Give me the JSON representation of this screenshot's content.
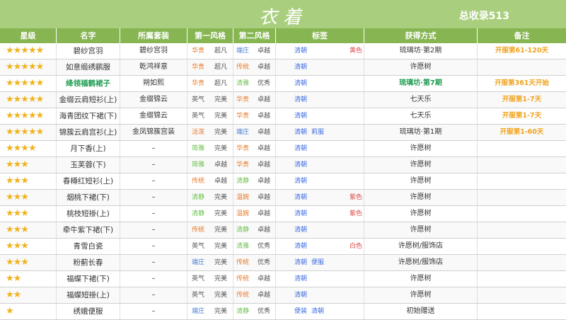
{
  "header": {
    "title": "衣着",
    "total": "总收录513"
  },
  "columns": [
    "星级",
    "名字",
    "所属套装",
    "第一风格",
    "第二风格",
    "标签",
    "获得方式",
    "备注"
  ],
  "colors": {
    "header_green": "#86b552",
    "title_green": "#a9cf7e",
    "star_gold": "#f0b31e",
    "style_orange": "#e87a2a",
    "style_green": "#6cbf4a",
    "style_blue": "#4a7fd0",
    "tag_blue": "#3f6ce0",
    "tag_red": "#e04a4a",
    "note_orange": "#f0a21e",
    "teal": "#1e9c50"
  },
  "rows": [
    {
      "stars": "★★★★★",
      "name": "碧纱宫羽",
      "set": "碧纱宫羽",
      "s1": "华贵",
      "s1c": "#e87a2a",
      "s1v": "超凡",
      "s2": "端庄",
      "s2c": "#4a7fd0",
      "s2v": "卓越",
      "tag1": "清朝",
      "tag2": "黄色",
      "tag2c": "#e04a4a",
      "obtain": "琉璃坊·第2期",
      "note": "开服第61-120天",
      "teal": false
    },
    {
      "stars": "★★★★★",
      "name": "如意缎绣鹂服",
      "set": "乾鸿祥意",
      "s1": "华贵",
      "s1c": "#e87a2a",
      "s1v": "超凡",
      "s2": "传统",
      "s2c": "#e87a2a",
      "s2v": "卓越",
      "tag1": "清朝",
      "tag2": "",
      "tag2c": "#e04a4a",
      "obtain": "许愿树",
      "note": "",
      "teal": false
    },
    {
      "stars": "★★★★★",
      "name": "绛领福鹤裙子",
      "set": "朔如熙",
      "s1": "华贵",
      "s1c": "#e87a2a",
      "s1v": "超凡",
      "s2": "清雅",
      "s2c": "#6cbf4a",
      "s2v": "优秀",
      "tag1": "清朝",
      "tag2": "",
      "tag2c": "#e04a4a",
      "obtain": "琉璃坊·第7期",
      "note": "开服第361天开始",
      "teal": true
    },
    {
      "stars": "★★★★★",
      "name": "金缀云肩短衫(上)",
      "set": "金缀锦云",
      "s1": "英气",
      "s1c": "#555555",
      "s1v": "完美",
      "s2": "华贵",
      "s2c": "#e87a2a",
      "s2v": "卓越",
      "tag1": "清朝",
      "tag2": "",
      "tag2c": "#e04a4a",
      "obtain": "七天乐",
      "note": "开服第1-7天",
      "teal": false
    },
    {
      "stars": "★★★★★",
      "name": "海青团纹下裙(下)",
      "set": "金缀锦云",
      "s1": "英气",
      "s1c": "#555555",
      "s1v": "完美",
      "s2": "华贵",
      "s2c": "#e87a2a",
      "s2v": "卓越",
      "tag1": "清朝",
      "tag2": "",
      "tag2c": "#e04a4a",
      "obtain": "七天乐",
      "note": "开服第1-7天",
      "teal": false
    },
    {
      "stars": "★★★★★",
      "name": "锦簇云肩宫衫(上)",
      "set": "金凤锦簇宫装",
      "s1": "活泼",
      "s1c": "#e87a2a",
      "s1v": "完美",
      "s2": "端庄",
      "s2c": "#4a7fd0",
      "s2v": "卓越",
      "tag1": "清朝",
      "tag2": "莉服",
      "tag2c": "#3f6ce0",
      "obtain": "琉璃坊·第1期",
      "note": "开服第1-60天",
      "teal": false
    },
    {
      "stars": "★★★★",
      "name": "月下香(上)",
      "set": "–",
      "s1": "简雅",
      "s1c": "#6cbf4a",
      "s1v": "完美",
      "s2": "华贵",
      "s2c": "#e87a2a",
      "s2v": "卓越",
      "tag1": "清朝",
      "tag2": "",
      "tag2c": "#e04a4a",
      "obtain": "许愿树",
      "note": "",
      "teal": false
    },
    {
      "stars": "★★★",
      "name": "玉芙蓉(下)",
      "set": "–",
      "s1": "简雅",
      "s1c": "#6cbf4a",
      "s1v": "卓越",
      "s2": "华贵",
      "s2c": "#e87a2a",
      "s2v": "卓越",
      "tag1": "清朝",
      "tag2": "",
      "tag2c": "#e04a4a",
      "obtain": "许愿树",
      "note": "",
      "teal": false
    },
    {
      "stars": "★★★",
      "name": "春樽红短衫(上)",
      "set": "–",
      "s1": "传统",
      "s1c": "#e87a2a",
      "s1v": "卓越",
      "s2": "清静",
      "s2c": "#6cbf4a",
      "s2v": "卓越",
      "tag1": "清朝",
      "tag2": "",
      "tag2c": "#e04a4a",
      "obtain": "许愿树",
      "note": "",
      "teal": false
    },
    {
      "stars": "★★★",
      "name": "烟桃下裙(下)",
      "set": "–",
      "s1": "清静",
      "s1c": "#6cbf4a",
      "s1v": "完美",
      "s2": "温婉",
      "s2c": "#e87a2a",
      "s2v": "卓越",
      "tag1": "清朝",
      "tag2": "紫色",
      "tag2c": "#e04a4a",
      "obtain": "许愿树",
      "note": "",
      "teal": false
    },
    {
      "stars": "★★★",
      "name": "桃枝短褂(上)",
      "set": "–",
      "s1": "清静",
      "s1c": "#6cbf4a",
      "s1v": "完美",
      "s2": "温婉",
      "s2c": "#e87a2a",
      "s2v": "卓越",
      "tag1": "清朝",
      "tag2": "紫色",
      "tag2c": "#e04a4a",
      "obtain": "许愿树",
      "note": "",
      "teal": false
    },
    {
      "stars": "★★★",
      "name": "牵牛紫下裙(下)",
      "set": "–",
      "s1": "传统",
      "s1c": "#e87a2a",
      "s1v": "完美",
      "s2": "清静",
      "s2c": "#6cbf4a",
      "s2v": "卓越",
      "tag1": "清朝",
      "tag2": "",
      "tag2c": "#e04a4a",
      "obtain": "许愿树",
      "note": "",
      "teal": false
    },
    {
      "stars": "★★★",
      "name": "青雪白瓷",
      "set": "–",
      "s1": "英气",
      "s1c": "#555555",
      "s1v": "完美",
      "s2": "清雅",
      "s2c": "#6cbf4a",
      "s2v": "优秀",
      "tag1": "清朝",
      "tag2": "白色",
      "tag2c": "#e04a4a",
      "obtain": "许愿树/服饰店",
      "note": "",
      "teal": false
    },
    {
      "stars": "★★★",
      "name": "粉蓟长春",
      "set": "–",
      "s1": "端庄",
      "s1c": "#4a7fd0",
      "s1v": "完美",
      "s2": "传统",
      "s2c": "#e87a2a",
      "s2v": "优秀",
      "tag1": "清朝",
      "tag2": "便服",
      "tag2c": "#3f6ce0",
      "obtain": "许愿树/服饰店",
      "note": "",
      "teal": false
    },
    {
      "stars": "★★",
      "name": "福蝶下裙(下)",
      "set": "–",
      "s1": "英气",
      "s1c": "#555555",
      "s1v": "完美",
      "s2": "传统",
      "s2c": "#e87a2a",
      "s2v": "卓越",
      "tag1": "清朝",
      "tag2": "",
      "tag2c": "#e04a4a",
      "obtain": "许愿树",
      "note": "",
      "teal": false
    },
    {
      "stars": "★★",
      "name": "福蝶短褂(上)",
      "set": "–",
      "s1": "英气",
      "s1c": "#555555",
      "s1v": "完美",
      "s2": "传统",
      "s2c": "#e87a2a",
      "s2v": "卓越",
      "tag1": "清朝",
      "tag2": "",
      "tag2c": "#e04a4a",
      "obtain": "许愿树",
      "note": "",
      "teal": false
    },
    {
      "stars": "★",
      "name": "绣娥便服",
      "set": "–",
      "s1": "端庄",
      "s1c": "#4a7fd0",
      "s1v": "完美",
      "s2": "清静",
      "s2c": "#6cbf4a",
      "s2v": "优秀",
      "tag1": "便装",
      "tag2": "清朝",
      "tag2c": "#3f6ce0",
      "obtain": "初始赠送",
      "note": "",
      "teal": false
    }
  ]
}
